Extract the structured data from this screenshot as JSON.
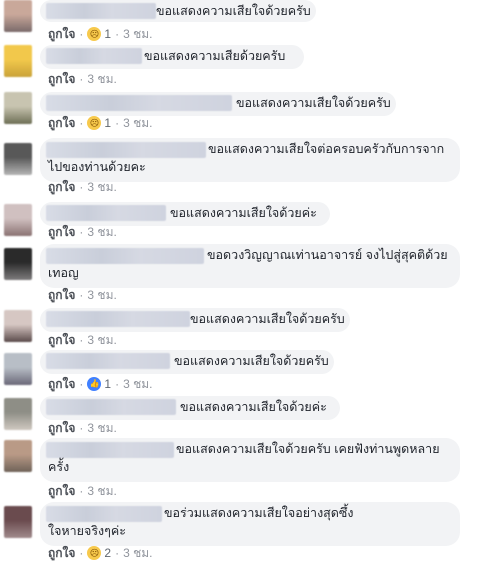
{
  "actions": {
    "like_label": "ถูกใจ",
    "separator": "·"
  },
  "comments": [
    {
      "text_lines": [
        "ขอแสดงความเสียใจด้วยครับ"
      ],
      "reaction": "sad-reaction-icon",
      "react_count": "1",
      "time": "3 ชม."
    },
    {
      "text_lines": [
        "ขอแสดงความเสียด้วยครับ"
      ],
      "reaction": "",
      "react_count": "",
      "time": "3 ชม."
    },
    {
      "text_lines": [
        "ขอแสดงความเสียใจด้วยครับ"
      ],
      "reaction": "sad-reaction-icon",
      "react_count": "1",
      "time": "3 ชม."
    },
    {
      "text_lines": [
        "ขอแสดงความเสียใจต่อครอบครัวกับการจาก",
        "ไปของท่านด้วยคะ"
      ],
      "reaction": "",
      "react_count": "",
      "time": "3 ชม."
    },
    {
      "text_lines": [
        "ขอแสดงความเสียใจด้วยค่ะ"
      ],
      "reaction": "",
      "react_count": "",
      "time": "3 ชม."
    },
    {
      "text_lines": [
        "ขอดวงวิญญาณเท่านอาจารย์ จงไปสู่สุคติด้วย",
        "เทอญ"
      ],
      "reaction": "",
      "react_count": "",
      "time": "3 ชม."
    },
    {
      "text_lines": [
        "ขอแสดงความเสียใจด้วยครับ"
      ],
      "reaction": "",
      "react_count": "",
      "time": "3 ชม."
    },
    {
      "text_lines": [
        "ขอแสดงความเสียใจด้วยครับ"
      ],
      "reaction": "like-reaction-icon",
      "react_count": "1",
      "time": "3 ชม."
    },
    {
      "text_lines": [
        "ขอแสดงความเสียใจด้วยค่ะ"
      ],
      "reaction": "",
      "react_count": "",
      "time": "3 ชม."
    },
    {
      "text_lines": [
        "ขอแสดงความเสียใจด้วยครับ เคยฟังท่านพูดหลาย",
        "ครั้ง"
      ],
      "reaction": "",
      "react_count": "",
      "time": "3 ชม."
    },
    {
      "text_lines": [
        "ขอร่วมแสดงความเสียใจอย่างสุดซึ้ง",
        "ใจหายจริงๆค่ะ"
      ],
      "reaction": "sad-reaction-icon",
      "react_count": "2",
      "time": "3 ชม."
    }
  ]
}
